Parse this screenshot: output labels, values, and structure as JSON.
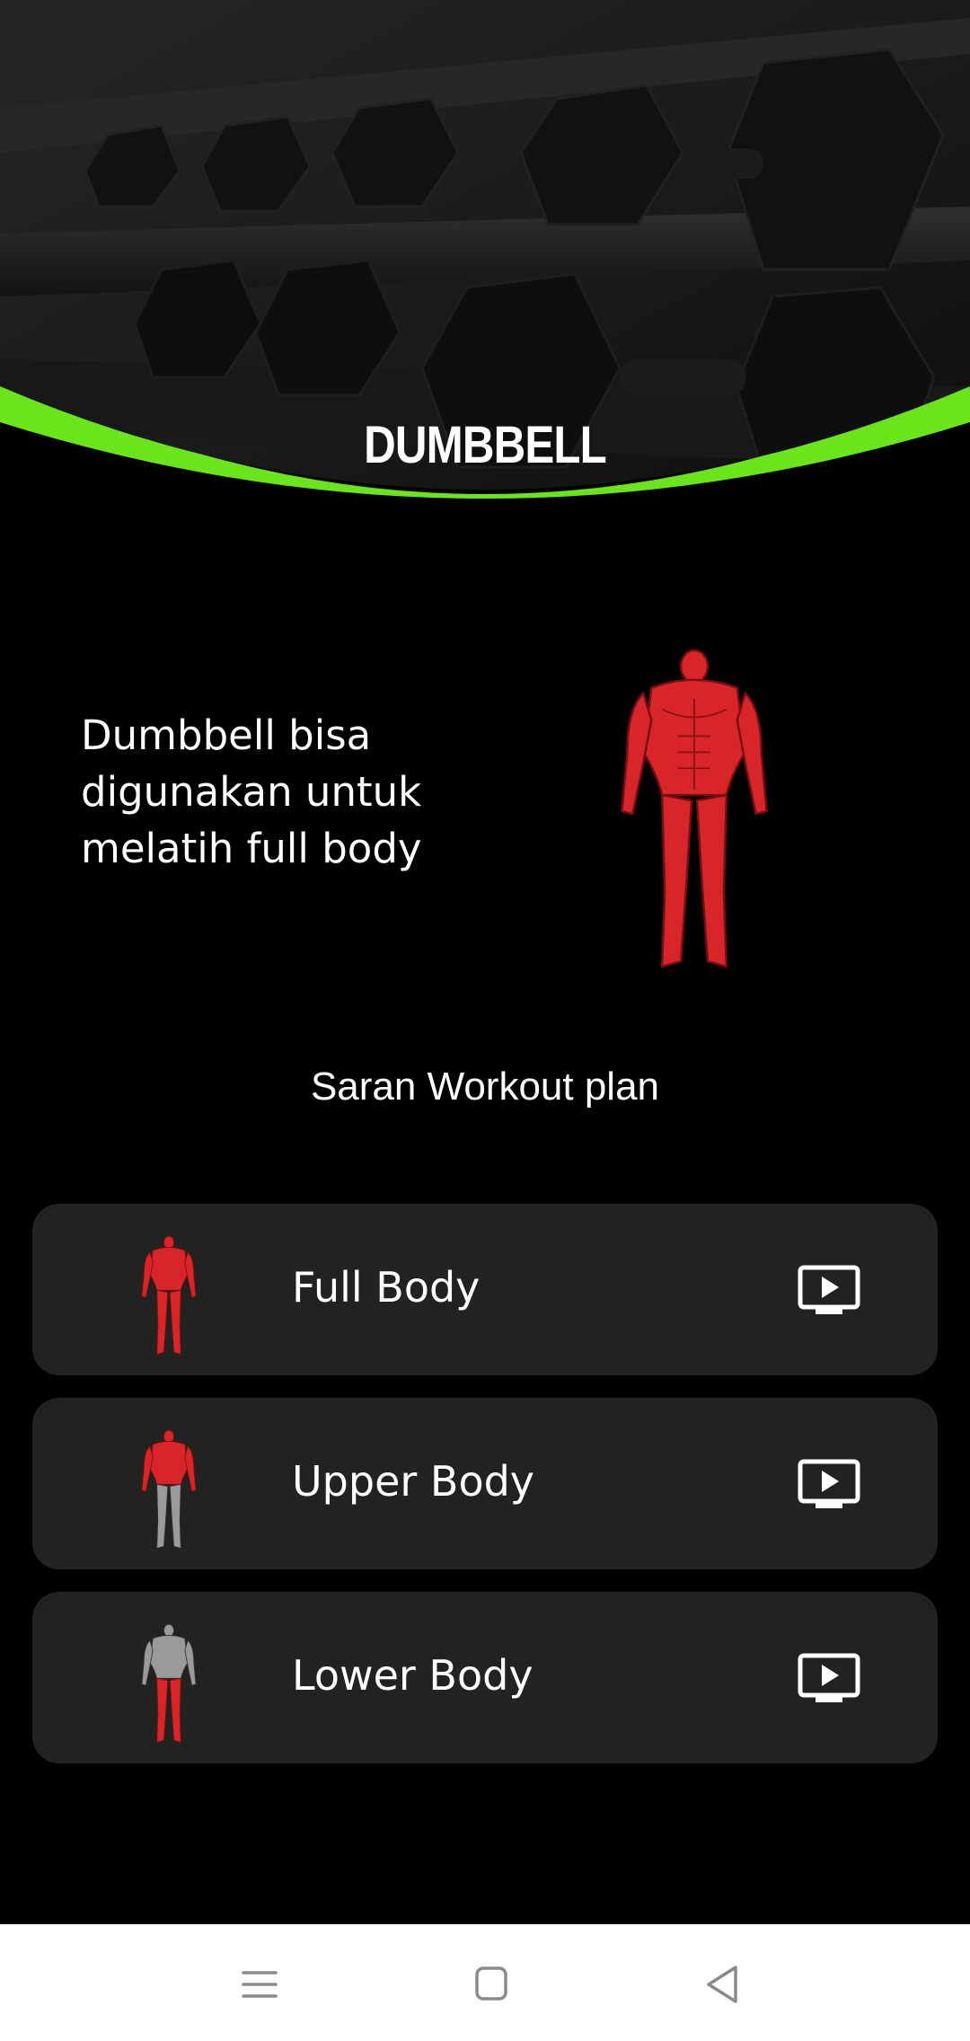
{
  "header": {
    "title": "DUMBBELL",
    "accent_color": "#6BE51B"
  },
  "intro": {
    "text": "Dumbbell bisa digunakan untuk melatih full body",
    "figure_icon": "full-body-muscle-figure"
  },
  "section": {
    "title": "Saran Workout plan"
  },
  "plans": [
    {
      "label": "Full Body",
      "figure_icon": "full-body-muscle-figure",
      "action_icon": "play-video-icon"
    },
    {
      "label": "Upper Body",
      "figure_icon": "upper-body-muscle-figure",
      "action_icon": "play-video-icon"
    },
    {
      "label": "Lower Body",
      "figure_icon": "lower-body-muscle-figure",
      "action_icon": "play-video-icon"
    }
  ],
  "navbar": {
    "items": [
      "menu-icon",
      "home-icon",
      "back-icon"
    ]
  },
  "colors": {
    "background": "#000000",
    "card": "#222321",
    "muscle_red": "#D8252A",
    "muscle_grey": "#9A9A9A"
  }
}
